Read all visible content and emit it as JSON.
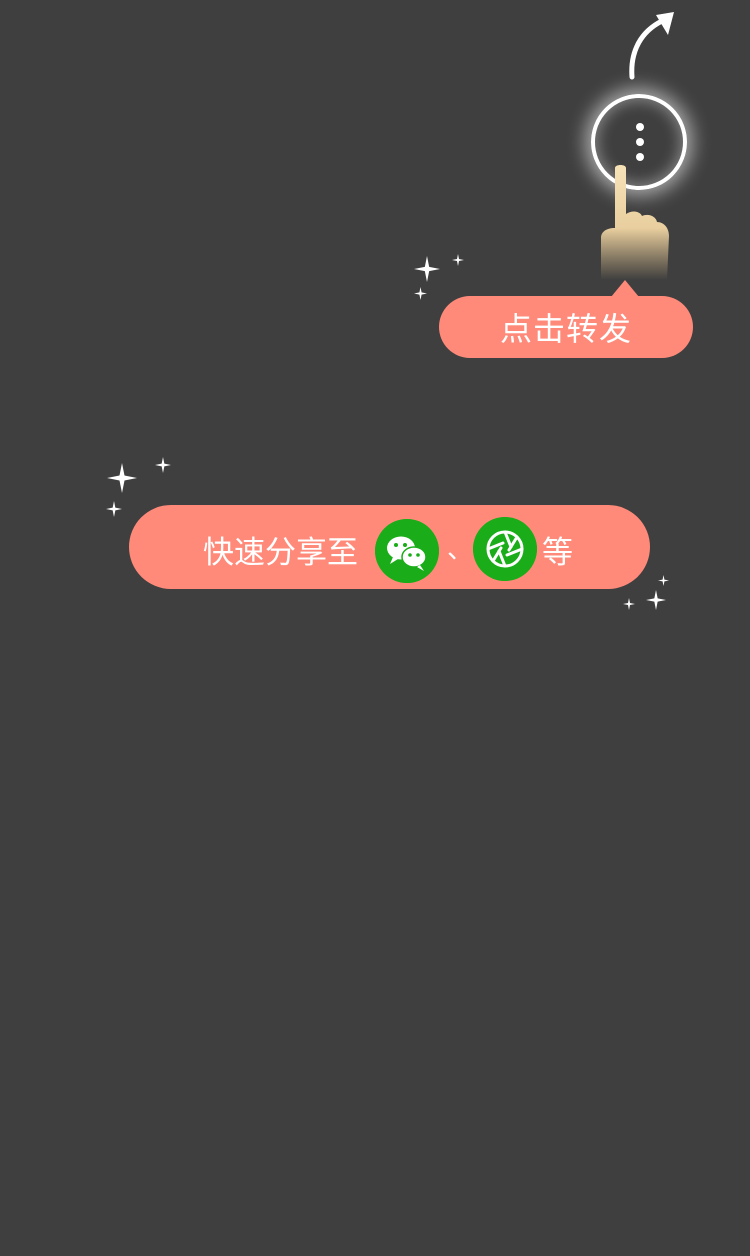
{
  "colors": {
    "background": "#3f3f3f",
    "accent": "#ff8a7a",
    "wechat_green": "#1aad19",
    "icon_white": "#ffffff"
  },
  "guide": {
    "arrow_icon": "curved-arrow-icon",
    "menu_button_icon": "more-vertical-icon",
    "hand_icon": "pointing-hand-icon",
    "tooltip_label": "点击转发"
  },
  "share": {
    "prefix_text": "快速分享至",
    "icons": [
      "wechat-icon",
      "moments-icon"
    ],
    "separator": "、",
    "suffix_text": "等"
  }
}
